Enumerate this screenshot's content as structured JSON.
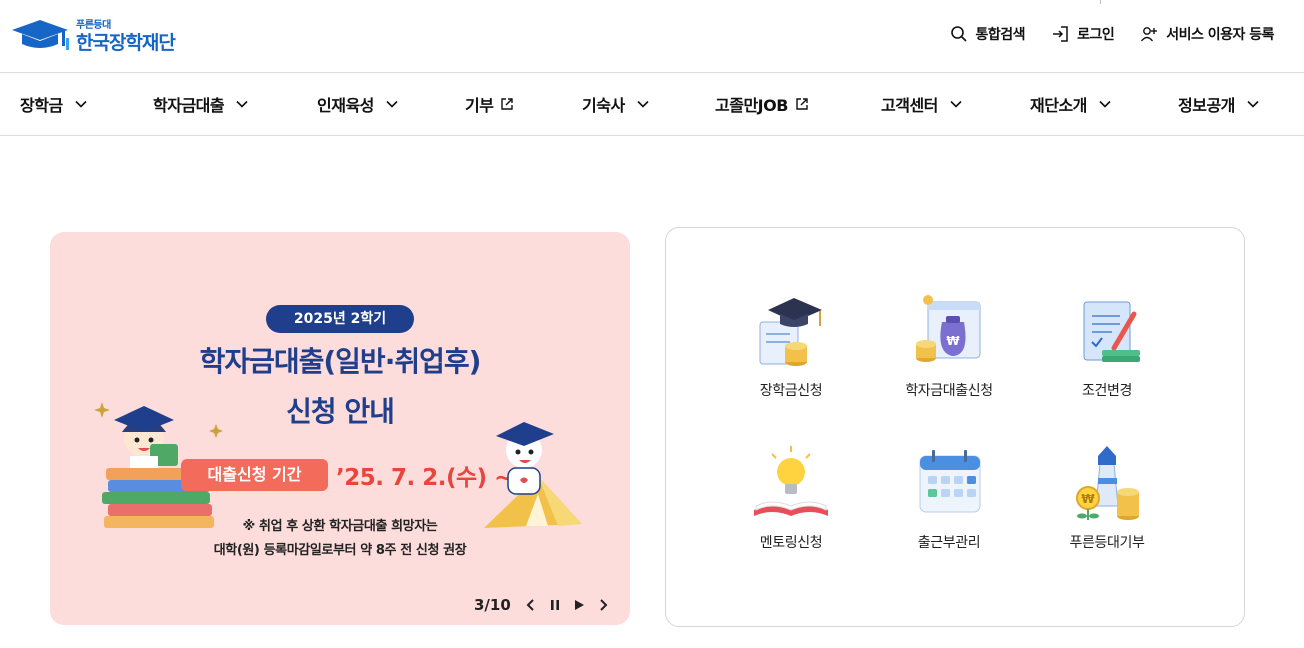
{
  "header": {
    "logo": {
      "small": "푸른등대",
      "name": "한국장학재단"
    },
    "utils": [
      {
        "label": "통합검색",
        "icon": "search-icon"
      },
      {
        "label": "로그인",
        "icon": "login-icon"
      },
      {
        "label": "서비스 이용자 등록",
        "icon": "user-add-icon"
      }
    ]
  },
  "nav": {
    "items": [
      {
        "label": "장학금",
        "icon": "chevron-down-icon"
      },
      {
        "label": "학자금대출",
        "icon": "chevron-down-icon"
      },
      {
        "label": "인재육성",
        "icon": "chevron-down-icon"
      },
      {
        "label": "기부",
        "icon": "external-link-icon"
      },
      {
        "label": "기숙사",
        "icon": "chevron-down-icon"
      },
      {
        "label": "고졸만JOB",
        "icon": "external-link-icon"
      },
      {
        "label": "고객센터",
        "icon": "chevron-down-icon"
      },
      {
        "label": "재단소개",
        "icon": "chevron-down-icon"
      },
      {
        "label": "정보공개",
        "icon": "chevron-down-icon"
      }
    ]
  },
  "banner": {
    "pill": "2025년 2학기",
    "title_line1": "학자금대출(일반·취업후)",
    "title_line2": "신청 안내",
    "period_label": "대출신청 기간",
    "period_date": "’25. 7. 2.(수) ~",
    "note_line1": "※ 취업 후 상환 학자금대출 희망자는",
    "note_line2": "대학(원) 등록마감일로부터 약 8주 전 신청 권장",
    "counter": "3/10",
    "bg_color": "#fddcdc",
    "accent_color": "#1f3f8c"
  },
  "quick": {
    "items": [
      {
        "label": "장학금신청",
        "icon": "graduation-cap-coins-icon"
      },
      {
        "label": "학자금대출신청",
        "icon": "money-bag-icon"
      },
      {
        "label": "조건변경",
        "icon": "document-pen-icon"
      },
      {
        "label": "멘토링신청",
        "icon": "lightbulb-book-icon"
      },
      {
        "label": "출근부관리",
        "icon": "calendar-icon"
      },
      {
        "label": "푸른등대기부",
        "icon": "lighthouse-coins-icon"
      }
    ]
  }
}
